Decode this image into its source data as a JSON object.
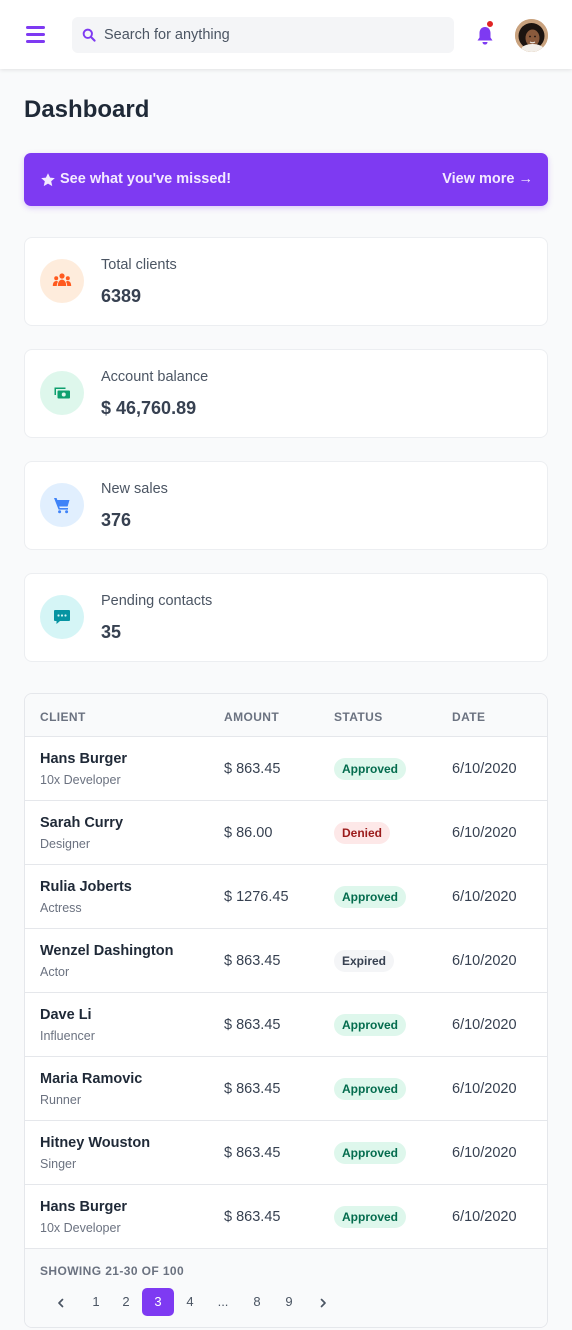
{
  "header": {
    "menu_icon": "hamburger-menu-icon",
    "search_placeholder": "Search for anything",
    "notification_icon": "bell-icon",
    "has_unread_notifications": true,
    "avatar_alt": "User avatar"
  },
  "page": {
    "title": "Dashboard"
  },
  "banner": {
    "text": "See what you've missed!",
    "link": "View more →",
    "icon": "star-icon",
    "color": "#7e3af2"
  },
  "cards": [
    {
      "label": "Total clients",
      "value": "6389",
      "icon": "people-icon",
      "color": "#ff5a1f",
      "bg": "#feecdc"
    },
    {
      "label": "Account balance",
      "value": "$ 46,760.89",
      "icon": "cash-icon",
      "color": "#0e9f6e",
      "bg": "#def7ec"
    },
    {
      "label": "New sales",
      "value": "376",
      "icon": "cart-icon",
      "color": "#3f83f8",
      "bg": "#e1effe"
    },
    {
      "label": "Pending contacts",
      "value": "35",
      "icon": "chat-icon",
      "color": "#0694a2",
      "bg": "#d5f5f6"
    }
  ],
  "table": {
    "columns": [
      "CLIENT",
      "AMOUNT",
      "STATUS",
      "DATE"
    ],
    "rows": [
      {
        "name": "Hans Burger",
        "role": "10x Developer",
        "amount": "$ 863.45",
        "status": "Approved",
        "date": "6/10/2020"
      },
      {
        "name": "Sarah Curry",
        "role": "Designer",
        "amount": "$ 86.00",
        "status": "Denied",
        "date": "6/10/2020"
      },
      {
        "name": "Rulia Joberts",
        "role": "Actress",
        "amount": "$ 1276.45",
        "status": "Approved",
        "date": "6/10/2020"
      },
      {
        "name": "Wenzel Dashington",
        "role": "Actor",
        "amount": "$ 863.45",
        "status": "Expired",
        "date": "6/10/2020"
      },
      {
        "name": "Dave Li",
        "role": "Influencer",
        "amount": "$ 863.45",
        "status": "Approved",
        "date": "6/10/2020"
      },
      {
        "name": "Maria Ramovic",
        "role": "Runner",
        "amount": "$ 863.45",
        "status": "Approved",
        "date": "6/10/2020"
      },
      {
        "name": "Hitney Wouston",
        "role": "Singer",
        "amount": "$ 863.45",
        "status": "Approved",
        "date": "6/10/2020"
      },
      {
        "name": "Hans Burger",
        "role": "10x Developer",
        "amount": "$ 863.45",
        "status": "Approved",
        "date": "6/10/2020"
      }
    ],
    "footer": {
      "showing": "SHOWING 21-30 OF 100",
      "pages": [
        "1",
        "2",
        "3",
        "4",
        "...",
        "8",
        "9"
      ],
      "current_page": "3",
      "prev_icon": "chevron-left-icon",
      "next_icon": "chevron-right-icon"
    }
  }
}
